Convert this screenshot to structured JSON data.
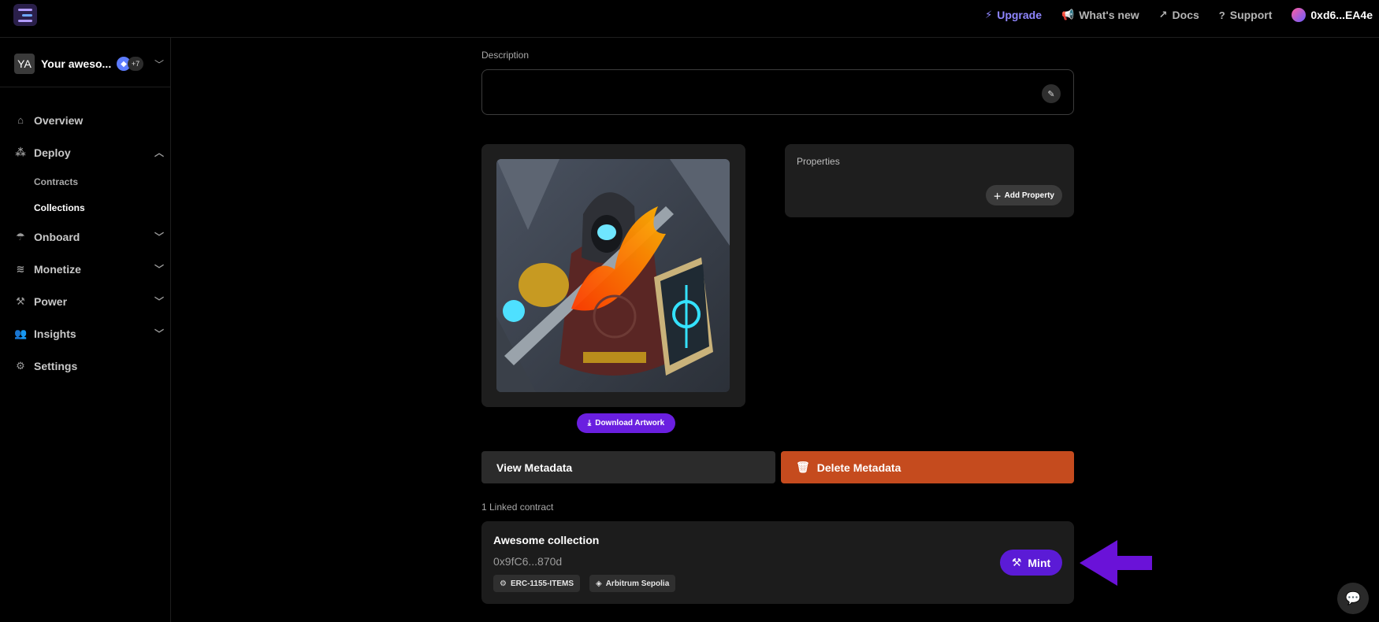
{
  "topbar": {
    "upgrade": "Upgrade",
    "whats_new": "What's new",
    "docs": "Docs",
    "support": "Support",
    "wallet": "0xd6...EA4e"
  },
  "sidebar": {
    "team_initials": "YA",
    "team_name": "Your aweso...",
    "team_more": "+7",
    "items": [
      {
        "label": "Overview",
        "icon": "home-icon"
      },
      {
        "label": "Deploy",
        "icon": "deploy-icon",
        "sub": [
          "Contracts",
          "Collections"
        ],
        "active_sub": "Collections"
      },
      {
        "label": "Onboard",
        "icon": "onboard-icon"
      },
      {
        "label": "Monetize",
        "icon": "monetize-icon"
      },
      {
        "label": "Power",
        "icon": "power-icon"
      },
      {
        "label": "Insights",
        "icon": "insights-icon"
      },
      {
        "label": "Settings",
        "icon": "gear-icon"
      }
    ]
  },
  "main": {
    "description_label": "Description",
    "properties_title": "Properties",
    "add_property": "Add Property",
    "download_artwork": "Download Artwork",
    "view_metadata": "View Metadata",
    "delete_metadata": "Delete Metadata",
    "linked_label": "1 Linked contract",
    "linked_contract": {
      "name": "Awesome collection",
      "address": "0x9fC6...870d",
      "standard": "ERC-1155-ITEMS",
      "network": "Arbitrum Sepolia",
      "mint_label": "Mint"
    }
  },
  "colors": {
    "accent": "#5b1bd6",
    "upgrade": "#8f86ff",
    "danger": "#c54b1e",
    "arrow": "#6a12d8"
  }
}
